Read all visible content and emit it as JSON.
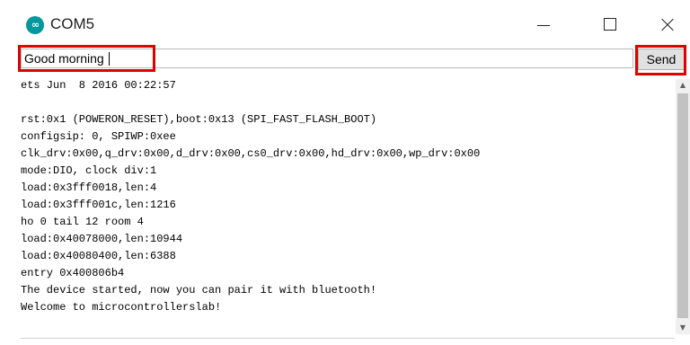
{
  "window": {
    "title": "COM5",
    "icon_glyph": "∞"
  },
  "input": {
    "value": "Good morning"
  },
  "send_label": "Send",
  "highlight_color": "#e00000",
  "output_lines": [
    "ets Jun  8 2016 00:22:57",
    "",
    "rst:0x1 (POWERON_RESET),boot:0x13 (SPI_FAST_FLASH_BOOT)",
    "configsip: 0, SPIWP:0xee",
    "clk_drv:0x00,q_drv:0x00,d_drv:0x00,cs0_drv:0x00,hd_drv:0x00,wp_drv:0x00",
    "mode:DIO, clock div:1",
    "load:0x3fff0018,len:4",
    "load:0x3fff001c,len:1216",
    "ho 0 tail 12 room 4",
    "load:0x40078000,len:10944",
    "load:0x40080400,len:6388",
    "entry 0x400806b4",
    "The device started, now you can pair it with bluetooth!",
    "Welcome to microcontrollerslab!"
  ]
}
